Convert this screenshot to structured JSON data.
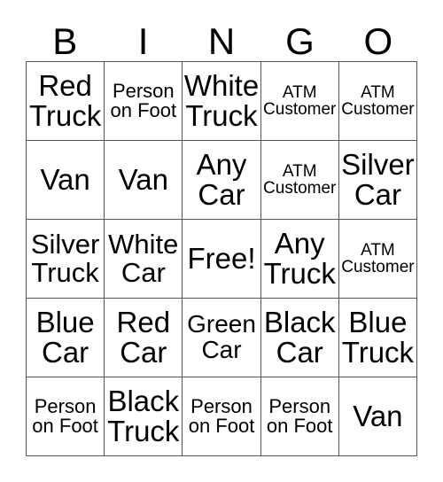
{
  "card": {
    "title_letters": [
      "B",
      "I",
      "N",
      "G",
      "O"
    ],
    "rows": [
      [
        {
          "text": "Red Truck",
          "size": "xl"
        },
        {
          "text": "Person on Foot",
          "size": "xs"
        },
        {
          "text": "White Truck",
          "size": "xl"
        },
        {
          "text": "ATM Customer",
          "size": "sm"
        },
        {
          "text": "ATM Customer",
          "size": "sm"
        }
      ],
      [
        {
          "text": "Van",
          "size": "xl"
        },
        {
          "text": "Van",
          "size": "xl"
        },
        {
          "text": "Any Car",
          "size": "xl"
        },
        {
          "text": "ATM Customer",
          "size": "sm"
        },
        {
          "text": "Silver Car",
          "size": "xl"
        }
      ],
      [
        {
          "text": "Silver Truck",
          "size": "lg"
        },
        {
          "text": "White Car",
          "size": "lg"
        },
        {
          "text": "Free!",
          "size": "xl"
        },
        {
          "text": "Any Truck",
          "size": "xl"
        },
        {
          "text": "ATM Customer",
          "size": "sm"
        }
      ],
      [
        {
          "text": "Blue Car",
          "size": "xl"
        },
        {
          "text": "Red Car",
          "size": "xl"
        },
        {
          "text": "Green Car",
          "size": "md"
        },
        {
          "text": "Black Car",
          "size": "xl"
        },
        {
          "text": "Blue Truck",
          "size": "xl"
        }
      ],
      [
        {
          "text": "Person on Foot",
          "size": "xs"
        },
        {
          "text": "Black Truck",
          "size": "xl"
        },
        {
          "text": "Person on Foot",
          "size": "xs"
        },
        {
          "text": "Person on Foot",
          "size": "xs"
        },
        {
          "text": "Van",
          "size": "xl"
        }
      ]
    ],
    "free_space": "Free!",
    "colors": {
      "background": "#ffffff",
      "text": "#000000",
      "grid_line": "#555555"
    }
  }
}
